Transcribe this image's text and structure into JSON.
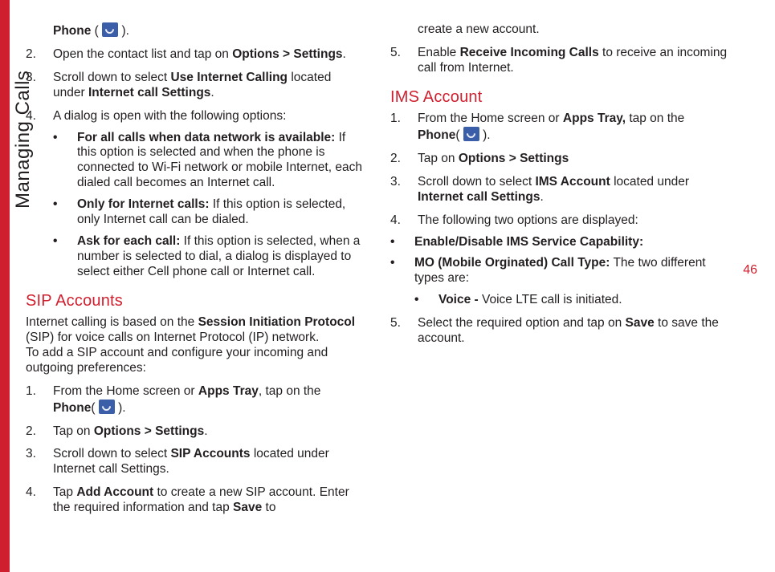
{
  "sideLabel": "Managing Calls",
  "pageNumber": "46",
  "col1": {
    "line0_pre": "Phone",
    "line0_post": " ( ",
    "line0_end": " ).",
    "s2_n": "2.",
    "s2_t1": "Open the contact list and tap on ",
    "s2_b1": "Options > Settings",
    "s2_t2": ".",
    "s3_n": "3.",
    "s3_t1": "Scroll down to select ",
    "s3_b1": "Use Internet Calling",
    "s3_t2": " located under ",
    "s3_b2": "Internet call Settings",
    "s3_t3": ".",
    "s4_n": "4.",
    "s4_t1": "A dialog is open with the following options:",
    "b1_b": "For all calls when data network is available:",
    "b1_t": " If this option is selected and when the phone is connected to Wi-Fi network or mobile Internet, each dialed call becomes an Internet call.",
    "b2_b": "Only for Internet calls:",
    "b2_t": " If this option is selected, only Internet call can be dialed.",
    "b3_b": "Ask for each call:",
    "b3_t": " If this option is selected, when a number is selected to dial, a dialog is displayed to select either Cell phone call or Internet call.",
    "h_sip": "SIP Accounts",
    "sip_p1a": "Internet calling is based on the ",
    "sip_p1b": "Session Initiation Protocol",
    "sip_p1c": " (SIP) for voice calls on Internet Protocol (IP) network.",
    "sip_p2": "To add a SIP account and configure your incoming and outgoing preferences:",
    "sip1_n": "1.",
    "sip1_t1": "From the Home screen or ",
    "sip1_b1": "Apps Tray",
    "sip1_t2": ", tap on the ",
    "sip1_b2": "Phone",
    "sip1_t3": "( ",
    "sip1_t4": " ).",
    "sip2_n": "2.",
    "sip2_t1": "Tap on ",
    "sip2_b1": "Options > Settings",
    "sip2_t2": ".",
    "sip3_n": "3.",
    "sip3_t1": "Scroll down to select ",
    "sip3_b1": "SIP Accounts",
    "sip3_t2": " located under Internet call Settings.",
    "sip4_n": "4.",
    "sip4_t1": "Tap ",
    "sip4_b1": "Add Account",
    "sip4_t2": " to create a new SIP account. Enter the required information and tap ",
    "sip4_b2": "Save",
    "sip4_t3": " to"
  },
  "col2": {
    "cont": "create a new account.",
    "s5_n": "5.",
    "s5_t1": "Enable ",
    "s5_b1": "Receive Incoming Calls",
    "s5_t2": " to receive an incoming call from Internet.",
    "h_ims": "IMS Account",
    "i1_n": "1.",
    "i1_t1": "From the Home screen or ",
    "i1_b1": "Apps Tray,",
    "i1_t2": " tap on the ",
    "i1_b2": "Phone",
    "i1_t3": "( ",
    "i1_t4": " ).",
    "i2_n": "2.",
    "i2_t1": "Tap on ",
    "i2_b1": "Options > Settings",
    "i3_n": "3.",
    "i3_t1": "Scroll down to select ",
    "i3_b1": "IMS Account",
    "i3_t2": " located under ",
    "i3_b2": "Internet call Settings",
    "i3_t3": ".",
    "i4_n": "4.",
    "i4_t1": "The following two options are displayed:",
    "ib1_b": "Enable/Disable IMS Service Capability:",
    "ib2_b": "MO (Mobile Orginated) Call Type:",
    "ib2_t": " The two different types are:",
    "ibv_b": "Voice -",
    "ibv_t": " Voice LTE call is initiated.",
    "i5_n": "5.",
    "i5_t1": "Select the required option and tap on ",
    "i5_b1": "Save",
    "i5_t2": " to save the account."
  }
}
